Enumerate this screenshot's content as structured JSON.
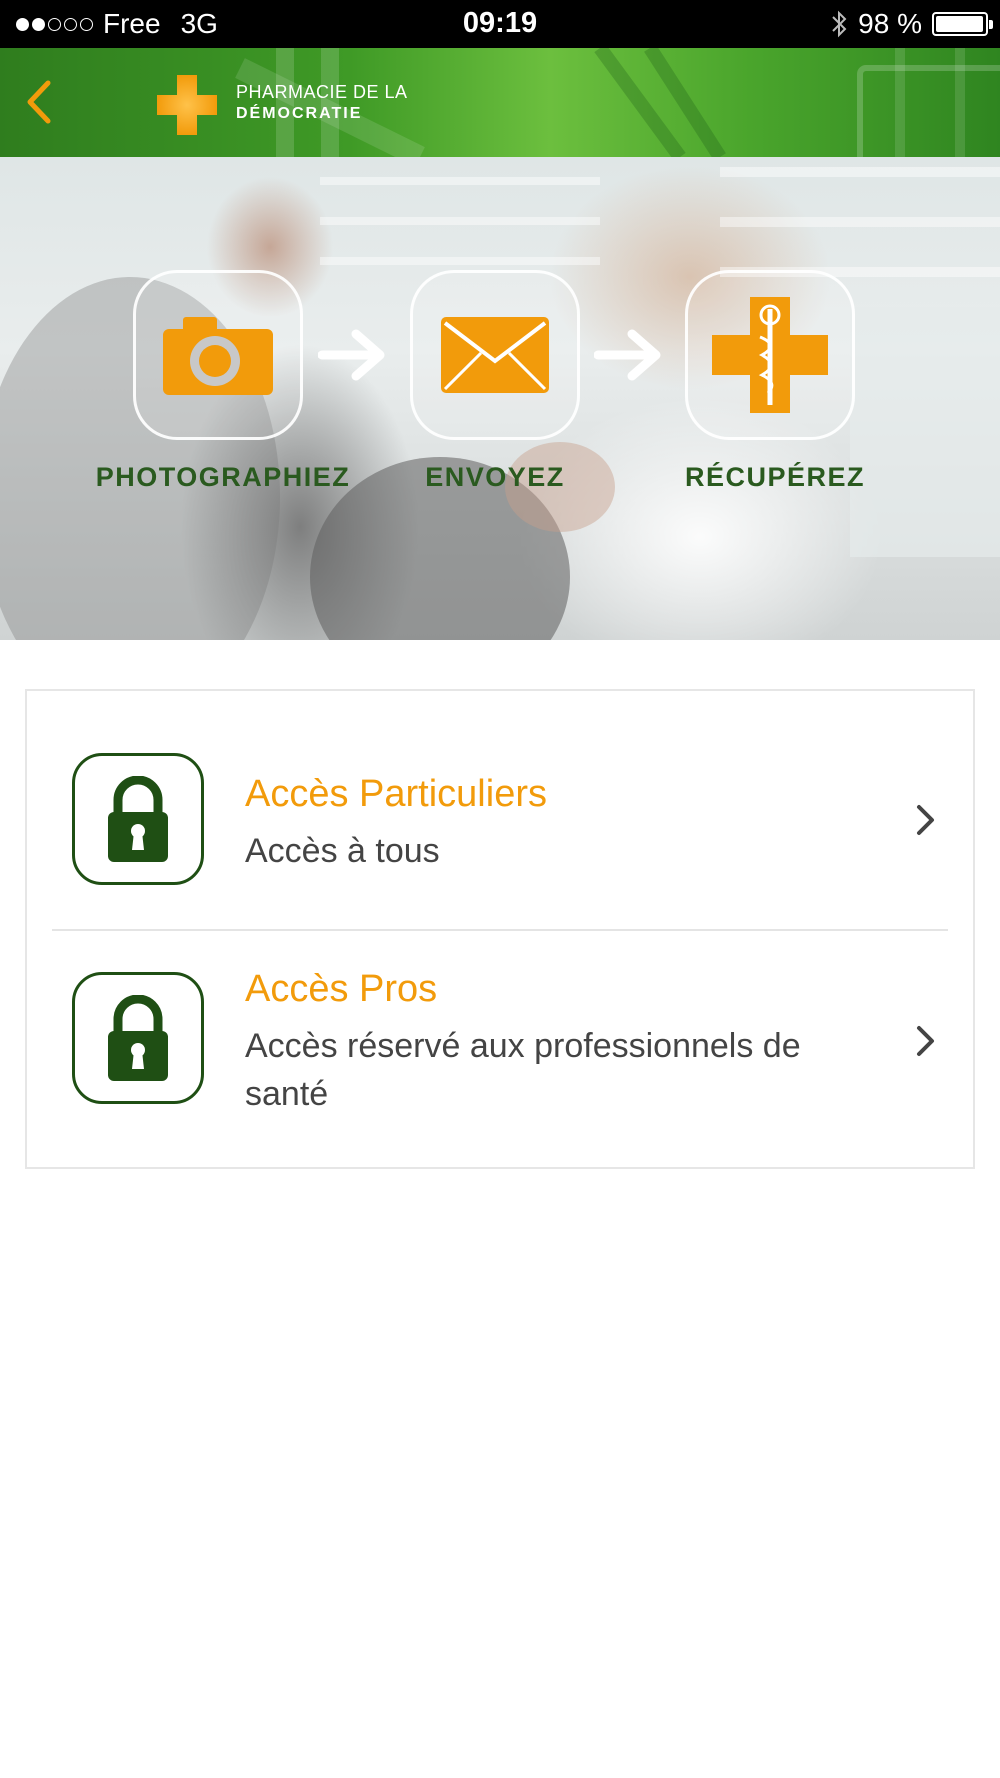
{
  "status_bar": {
    "signal_dots": [
      "filled",
      "filled",
      "empty",
      "empty",
      "empty"
    ],
    "carrier": "Free",
    "network": "3G",
    "time": "09:19",
    "battery_text": "98 %",
    "battery_level": 0.98
  },
  "header": {
    "back_icon": "chevron-left-icon",
    "logo_line1": "PHARMACIE DE LA",
    "logo_line2": "DÉMOCRATIE",
    "accent_color": "#f29b0b"
  },
  "hero": {
    "steps": [
      {
        "icon": "camera-icon",
        "label": "PHOTOGRAPHIEZ"
      },
      {
        "icon": "envelope-icon",
        "label": "ENVOYEZ"
      },
      {
        "icon": "pharmacy-cross-icon",
        "label": "RÉCUPÉREZ"
      }
    ]
  },
  "access": {
    "items": [
      {
        "icon": "lock-icon",
        "title": "Accès Particuliers",
        "subtitle": "Accès à tous"
      },
      {
        "icon": "lock-icon",
        "title": "Accès Pros",
        "subtitle": "Accès réservé aux professionnels de santé"
      }
    ]
  },
  "colors": {
    "header_green": "#3f9a26",
    "dark_green": "#1f4f14",
    "orange": "#f29b0b",
    "label_green": "#2a5a1f"
  }
}
